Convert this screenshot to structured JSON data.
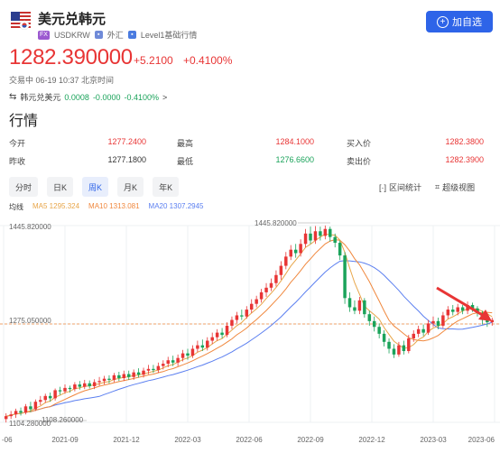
{
  "header": {
    "title": "美元兑韩元",
    "tag_fx": "FX",
    "code": "USDKRW",
    "market": "外汇",
    "level": "Level1基础行情",
    "add_button": "加自选"
  },
  "quote": {
    "price": "1282.390000",
    "change": "+5.2100",
    "change_pct": "+0.4100%",
    "status": "交易中 06-19 10:37 北京时间",
    "reverse_label": "韩元兑美元",
    "reverse_value": "0.0008",
    "reverse_change": "-0.0000",
    "reverse_pct": "-0.4100%",
    "reverse_arrow": ">"
  },
  "section_title": "行情",
  "stats": [
    {
      "label": "今开",
      "value": "1277.2400",
      "color": "red"
    },
    {
      "label": "最高",
      "value": "1284.1000",
      "color": "red"
    },
    {
      "label": "买入价",
      "value": "1282.3800",
      "color": "red"
    },
    {
      "label": "昨收",
      "value": "1277.1800",
      "color": "plain"
    },
    {
      "label": "最低",
      "value": "1276.6600",
      "color": "green"
    },
    {
      "label": "卖出价",
      "value": "1282.3900",
      "color": "red"
    }
  ],
  "tabs": [
    "分时",
    "日K",
    "周K",
    "月K",
    "年K"
  ],
  "active_tab": "周K",
  "tools": {
    "interval": "区间统计",
    "super_view": "超级视图"
  },
  "legend": {
    "title": "均线",
    "ma5": "MA5 1295.324",
    "ma10": "MA10 1313.081",
    "ma20": "MA20 1307.2945",
    "ma5_color": "#e8a64a",
    "ma10_color": "#f0883e",
    "ma20_color": "#5b7ff0"
  },
  "chart_data": {
    "type": "candlestick",
    "y_top_label": "1445.820000",
    "y_mid_label": "1275.050000",
    "y_bottom_label": "1104.280000",
    "max_label": "1445.820000",
    "min_label": "1108.260000",
    "ylim": [
      1104.28,
      1445.82
    ],
    "reference_value": 1275.05,
    "x_labels": [
      "-06",
      "2021-09",
      "2021-12",
      "2022-03",
      "2022-06",
      "2022-09",
      "2022-12",
      "2023-03",
      "2023-06"
    ],
    "up_color": "#e83535",
    "down_color": "#1aa35a",
    "weeks": [
      [
        1110,
        1115,
        1104,
        1120
      ],
      [
        1115,
        1118,
        1110,
        1124
      ],
      [
        1118,
        1124,
        1112,
        1128
      ],
      [
        1124,
        1121,
        1116,
        1130
      ],
      [
        1121,
        1132,
        1118,
        1136
      ],
      [
        1132,
        1127,
        1122,
        1140
      ],
      [
        1127,
        1140,
        1124,
        1144
      ],
      [
        1140,
        1143,
        1134,
        1150
      ],
      [
        1143,
        1150,
        1138,
        1154
      ],
      [
        1150,
        1146,
        1140,
        1156
      ],
      [
        1146,
        1160,
        1142,
        1163
      ],
      [
        1160,
        1158,
        1152,
        1166
      ],
      [
        1158,
        1164,
        1154,
        1170
      ],
      [
        1164,
        1162,
        1156,
        1168
      ],
      [
        1162,
        1170,
        1158,
        1174
      ],
      [
        1170,
        1166,
        1161,
        1176
      ],
      [
        1166,
        1172,
        1162,
        1178
      ],
      [
        1172,
        1167,
        1163,
        1177
      ],
      [
        1167,
        1174,
        1162,
        1179
      ],
      [
        1174,
        1176,
        1168,
        1183
      ],
      [
        1176,
        1180,
        1170,
        1185
      ],
      [
        1180,
        1178,
        1172,
        1186
      ],
      [
        1178,
        1186,
        1174,
        1190
      ],
      [
        1186,
        1181,
        1176,
        1192
      ],
      [
        1181,
        1188,
        1176,
        1194
      ],
      [
        1188,
        1183,
        1178,
        1194
      ],
      [
        1183,
        1191,
        1178,
        1196
      ],
      [
        1191,
        1187,
        1182,
        1198
      ],
      [
        1187,
        1194,
        1182,
        1199
      ],
      [
        1194,
        1197,
        1188,
        1204
      ],
      [
        1197,
        1195,
        1190,
        1204
      ],
      [
        1195,
        1202,
        1190,
        1208
      ],
      [
        1202,
        1206,
        1196,
        1212
      ],
      [
        1206,
        1212,
        1200,
        1218
      ],
      [
        1212,
        1208,
        1202,
        1220
      ],
      [
        1208,
        1216,
        1202,
        1222
      ],
      [
        1216,
        1224,
        1210,
        1230
      ],
      [
        1224,
        1220,
        1213,
        1232
      ],
      [
        1220,
        1232,
        1216,
        1238
      ],
      [
        1232,
        1238,
        1226,
        1246
      ],
      [
        1238,
        1234,
        1228,
        1248
      ],
      [
        1234,
        1246,
        1229,
        1252
      ],
      [
        1246,
        1252,
        1240,
        1260
      ],
      [
        1252,
        1260,
        1246,
        1266
      ],
      [
        1260,
        1256,
        1250,
        1268
      ],
      [
        1256,
        1272,
        1252,
        1278
      ],
      [
        1272,
        1282,
        1266,
        1288
      ],
      [
        1282,
        1290,
        1276,
        1296
      ],
      [
        1290,
        1288,
        1282,
        1300
      ],
      [
        1288,
        1300,
        1284,
        1306
      ],
      [
        1300,
        1310,
        1294,
        1318
      ],
      [
        1310,
        1318,
        1304,
        1324
      ],
      [
        1318,
        1330,
        1312,
        1336
      ],
      [
        1330,
        1338,
        1322,
        1346
      ],
      [
        1338,
        1346,
        1332,
        1354
      ],
      [
        1346,
        1360,
        1340,
        1368
      ],
      [
        1360,
        1376,
        1352,
        1384
      ],
      [
        1376,
        1392,
        1370,
        1400
      ],
      [
        1392,
        1404,
        1386,
        1412
      ],
      [
        1404,
        1398,
        1390,
        1414
      ],
      [
        1398,
        1414,
        1392,
        1422
      ],
      [
        1414,
        1432,
        1408,
        1440
      ],
      [
        1432,
        1420,
        1414,
        1444
      ],
      [
        1420,
        1436,
        1414,
        1445
      ],
      [
        1436,
        1428,
        1420,
        1444
      ],
      [
        1428,
        1440,
        1422,
        1446
      ],
      [
        1440,
        1426,
        1418,
        1444
      ],
      [
        1426,
        1416,
        1408,
        1432
      ],
      [
        1416,
        1394,
        1386,
        1420
      ],
      [
        1394,
        1320,
        1310,
        1400
      ],
      [
        1320,
        1304,
        1296,
        1330
      ],
      [
        1304,
        1298,
        1292,
        1316
      ],
      [
        1298,
        1316,
        1292,
        1322
      ],
      [
        1316,
        1292,
        1286,
        1320
      ],
      [
        1292,
        1280,
        1272,
        1298
      ],
      [
        1280,
        1270,
        1262,
        1288
      ],
      [
        1270,
        1258,
        1250,
        1276
      ],
      [
        1258,
        1244,
        1236,
        1264
      ],
      [
        1244,
        1232,
        1224,
        1250
      ],
      [
        1232,
        1222,
        1216,
        1240
      ],
      [
        1222,
        1238,
        1218,
        1244
      ],
      [
        1238,
        1228,
        1222,
        1246
      ],
      [
        1228,
        1250,
        1224,
        1256
      ],
      [
        1250,
        1258,
        1244,
        1264
      ],
      [
        1258,
        1266,
        1252,
        1272
      ],
      [
        1266,
        1260,
        1254,
        1274
      ],
      [
        1260,
        1276,
        1256,
        1282
      ],
      [
        1276,
        1280,
        1270,
        1288
      ],
      [
        1280,
        1272,
        1266,
        1286
      ],
      [
        1272,
        1290,
        1268,
        1296
      ],
      [
        1290,
        1300,
        1284,
        1306
      ],
      [
        1300,
        1296,
        1290,
        1308
      ],
      [
        1296,
        1304,
        1290,
        1310
      ],
      [
        1304,
        1298,
        1292,
        1308
      ],
      [
        1298,
        1308,
        1292,
        1314
      ],
      [
        1308,
        1302,
        1296,
        1312
      ],
      [
        1302,
        1294,
        1288,
        1306
      ],
      [
        1294,
        1282,
        1274,
        1298
      ],
      [
        1282,
        1278,
        1270,
        1288
      ],
      [
        1278,
        1282,
        1272,
        1286
      ]
    ]
  }
}
